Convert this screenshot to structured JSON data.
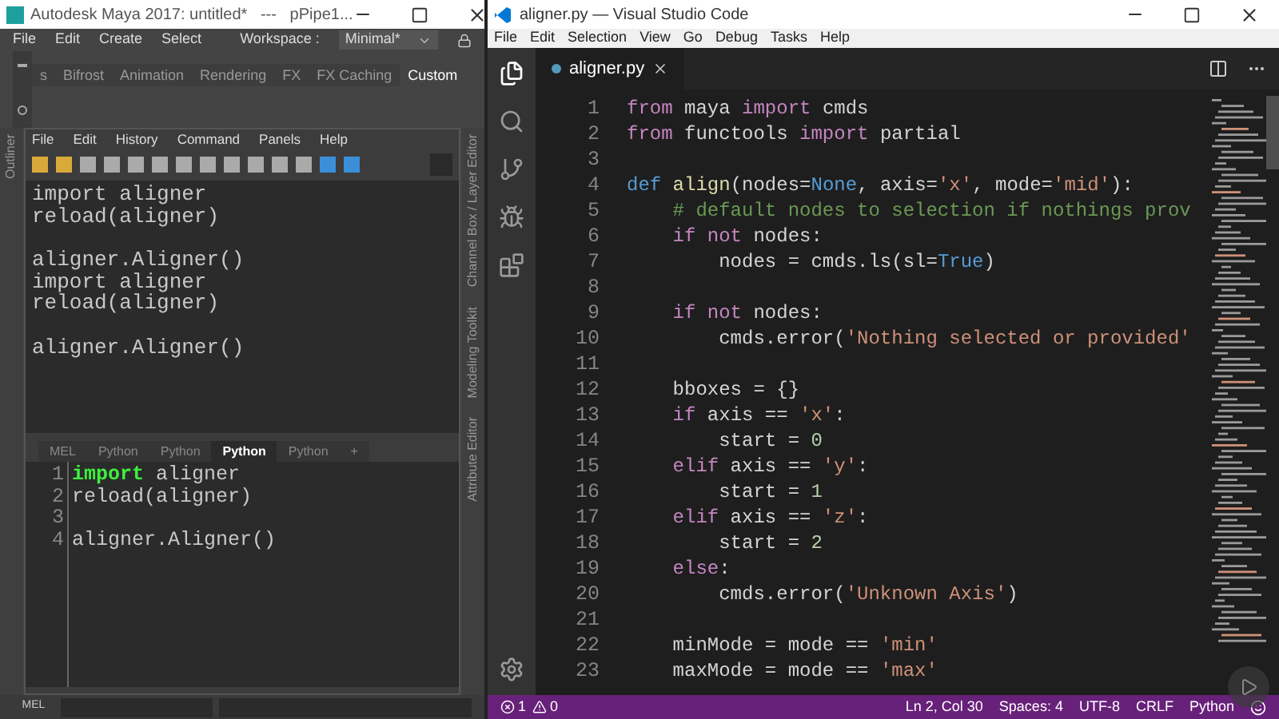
{
  "maya": {
    "title": "Autodesk Maya 2017: untitled*   ---   pPipe1...",
    "menu": [
      "File",
      "Edit",
      "Create",
      "Select"
    ],
    "workspace": {
      "label": "Workspace :",
      "value": "Minimal*"
    },
    "shelf_tabs": [
      {
        "label": "s",
        "selected": false
      },
      {
        "label": "Bifrost",
        "selected": false
      },
      {
        "label": "Animation",
        "selected": false
      },
      {
        "label": "Rendering",
        "selected": false
      },
      {
        "label": "FX",
        "selected": false
      },
      {
        "label": "FX Caching",
        "selected": false
      },
      {
        "label": "Custom",
        "selected": true
      }
    ],
    "left_panels": [
      "Outliner"
    ],
    "right_panels": [
      "Channel Box / Layer Editor",
      "Modeling Toolkit",
      "Attribute Editor"
    ],
    "script_editor": {
      "menu": [
        "File",
        "Edit",
        "History",
        "Command",
        "Panels",
        "Help"
      ],
      "history": [
        {
          "lines": [
            "import aligner",
            "reload(aligner)"
          ]
        },
        {
          "lines": [
            "aligner.Aligner()",
            "import aligner",
            "reload(aligner)"
          ]
        },
        {
          "lines": [
            "aligner.Aligner()"
          ]
        }
      ],
      "input_tabs": [
        {
          "label": "MEL",
          "selected": false
        },
        {
          "label": "Python",
          "selected": false
        },
        {
          "label": "Python",
          "selected": false
        },
        {
          "label": "Python",
          "selected": true
        },
        {
          "label": "Python",
          "selected": false
        },
        {
          "label": "+",
          "selected": false
        }
      ],
      "input_lines": [
        {
          "number": "1",
          "tokens": [
            {
              "kind": "kw",
              "text": "import"
            },
            {
              "kind": "plain",
              "text": " aligner"
            }
          ]
        },
        {
          "number": "2",
          "tokens": [
            {
              "kind": "plain",
              "text": "reload(aligner)"
            }
          ]
        },
        {
          "number": "3"
        },
        {
          "number": "4",
          "tokens": [
            {
              "kind": "plain",
              "text": "aligner.Aligner()"
            }
          ]
        }
      ]
    },
    "command_line": {
      "label": "MEL"
    }
  },
  "vscode": {
    "title": "aligner.py — Visual Studio Code",
    "menu": [
      "File",
      "Edit",
      "Selection",
      "View",
      "Go",
      "Debug",
      "Tasks",
      "Help"
    ],
    "tab": {
      "label": "aligner.py",
      "selected": true
    },
    "lines": [
      {
        "number": "1",
        "tokens": [
          {
            "kind": "kw",
            "text": "from"
          },
          {
            "kind": "plain",
            "text": " maya "
          },
          {
            "kind": "kw",
            "text": "import"
          },
          {
            "kind": "plain",
            "text": " cmds"
          }
        ]
      },
      {
        "number": "2",
        "tokens": [
          {
            "kind": "kw",
            "text": "from"
          },
          {
            "kind": "plain",
            "text": " functools "
          },
          {
            "kind": "kw",
            "text": "import"
          },
          {
            "kind": "plain",
            "text": " partial"
          }
        ]
      },
      {
        "number": "3"
      },
      {
        "number": "4",
        "tokens": [
          {
            "kind": "def",
            "text": "def"
          },
          {
            "kind": "fn",
            "text": " align"
          },
          {
            "kind": "plain",
            "text": "(nodes="
          },
          {
            "kind": "const",
            "text": "None"
          },
          {
            "kind": "plain",
            "text": ", axis="
          },
          {
            "kind": "str",
            "text": "'x'"
          },
          {
            "kind": "plain",
            "text": ", mode="
          },
          {
            "kind": "str",
            "text": "'mid'"
          },
          {
            "kind": "plain",
            "text": "):"
          }
        ]
      },
      {
        "number": "5",
        "tokens": [
          {
            "kind": "cmt",
            "text": "    # default nodes to selection if nothings prov"
          }
        ]
      },
      {
        "number": "6",
        "tokens": [
          {
            "kind": "kw",
            "text": "    if not"
          },
          {
            "kind": "plain",
            "text": " nodes:"
          }
        ]
      },
      {
        "number": "7",
        "tokens": [
          {
            "kind": "plain",
            "text": "        nodes = cmds.ls(sl="
          },
          {
            "kind": "const",
            "text": "True"
          },
          {
            "kind": "plain",
            "text": ")"
          }
        ]
      },
      {
        "number": "8"
      },
      {
        "number": "9",
        "tokens": [
          {
            "kind": "kw",
            "text": "    if not"
          },
          {
            "kind": "plain",
            "text": " nodes:"
          }
        ]
      },
      {
        "number": "10",
        "tokens": [
          {
            "kind": "plain",
            "text": "        cmds.error("
          },
          {
            "kind": "str",
            "text": "'Nothing selected or provided'"
          }
        ]
      },
      {
        "number": "11"
      },
      {
        "number": "12",
        "tokens": [
          {
            "kind": "plain",
            "text": "    bboxes = {}"
          }
        ]
      },
      {
        "number": "13",
        "tokens": [
          {
            "kind": "kw",
            "text": "    if"
          },
          {
            "kind": "plain",
            "text": " axis == "
          },
          {
            "kind": "str",
            "text": "'x'"
          },
          {
            "kind": "plain",
            "text": ":"
          }
        ]
      },
      {
        "number": "14",
        "tokens": [
          {
            "kind": "plain",
            "text": "        start = "
          },
          {
            "kind": "num",
            "text": "0"
          }
        ]
      },
      {
        "number": "15",
        "tokens": [
          {
            "kind": "kw",
            "text": "    elif"
          },
          {
            "kind": "plain",
            "text": " axis == "
          },
          {
            "kind": "str",
            "text": "'y'"
          },
          {
            "kind": "plain",
            "text": ":"
          }
        ]
      },
      {
        "number": "16",
        "tokens": [
          {
            "kind": "plain",
            "text": "        start = "
          },
          {
            "kind": "num",
            "text": "1"
          }
        ]
      },
      {
        "number": "17",
        "tokens": [
          {
            "kind": "kw",
            "text": "    elif"
          },
          {
            "kind": "plain",
            "text": " axis == "
          },
          {
            "kind": "str",
            "text": "'z'"
          },
          {
            "kind": "plain",
            "text": ":"
          }
        ]
      },
      {
        "number": "18",
        "tokens": [
          {
            "kind": "plain",
            "text": "        start = "
          },
          {
            "kind": "num",
            "text": "2"
          }
        ]
      },
      {
        "number": "19",
        "tokens": [
          {
            "kind": "kw",
            "text": "    else"
          },
          {
            "kind": "plain",
            "text": ":"
          }
        ]
      },
      {
        "number": "20",
        "tokens": [
          {
            "kind": "plain",
            "text": "        cmds.error("
          },
          {
            "kind": "str",
            "text": "'Unknown Axis'"
          },
          {
            "kind": "plain",
            "text": ")"
          }
        ]
      },
      {
        "number": "21"
      },
      {
        "number": "22",
        "tokens": [
          {
            "kind": "plain",
            "text": "    minMode = mode == "
          },
          {
            "kind": "str",
            "text": "'min'"
          }
        ]
      },
      {
        "number": "23",
        "tokens": [
          {
            "kind": "plain",
            "text": "    maxMode = mode == "
          },
          {
            "kind": "str",
            "text": "'max'"
          }
        ]
      }
    ],
    "status": {
      "errors": "1",
      "warnings": "0",
      "items": [
        "Ln 2, Col 30",
        "Spaces: 4",
        "UTF-8",
        "CRLF",
        "Python"
      ]
    }
  }
}
